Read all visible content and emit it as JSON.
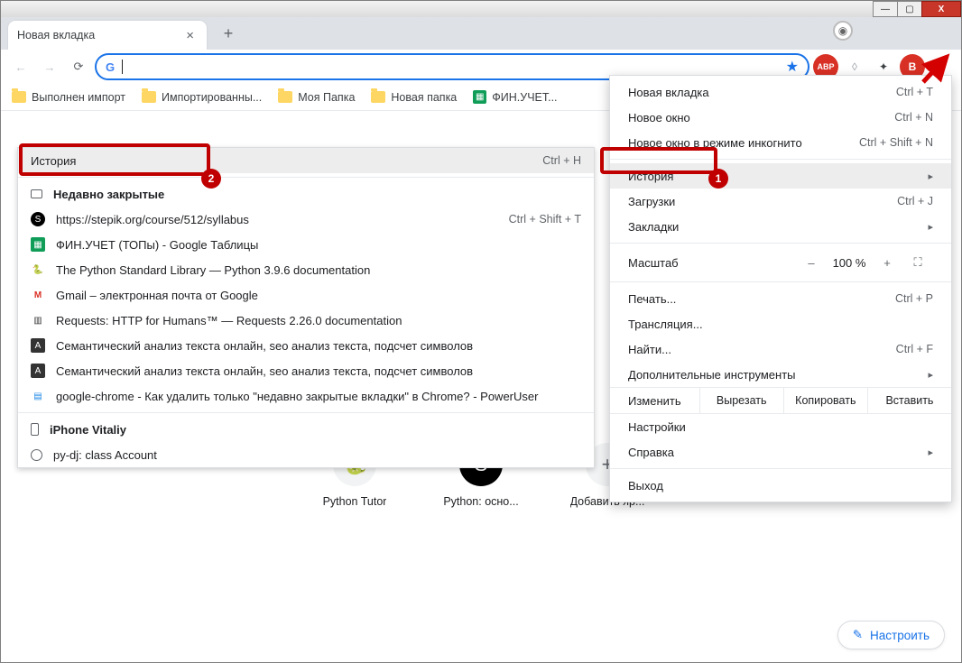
{
  "window": {
    "min": "—",
    "max": "▢",
    "close": "X"
  },
  "tab": {
    "title": "Новая вкладка"
  },
  "toolbar": {
    "profile_letter": "В",
    "abp": "ABP"
  },
  "bookmarks": [
    {
      "label": "Выполнен импорт",
      "type": "folder"
    },
    {
      "label": "Импортированны...",
      "type": "folder"
    },
    {
      "label": "Моя Папка",
      "type": "folder"
    },
    {
      "label": "Новая папка",
      "type": "folder"
    },
    {
      "label": "ФИН.УЧЕТ...",
      "type": "sheet"
    }
  ],
  "submenu": {
    "header": {
      "label": "История",
      "shortcut": "Ctrl + H"
    },
    "recent_label": "Недавно закрытые",
    "recent_shortcut": "Ctrl + Shift + T",
    "items": [
      {
        "icon": "stepik",
        "label": "https://stepik.org/course/512/syllabus"
      },
      {
        "icon": "sheets",
        "label": "ФИН.УЧЕТ (ТОПы) - Google Таблицы"
      },
      {
        "icon": "python",
        "label": "The Python Standard Library — Python 3.9.6 documentation"
      },
      {
        "icon": "gmail",
        "label": "Gmail – электронная почта от Google"
      },
      {
        "icon": "requests",
        "label": "Requests: HTTP for Humans™ — Requests 2.26.0 documentation"
      },
      {
        "icon": "advego",
        "label": "Семантический анализ текста онлайн, seo анализ текста, подсчет символов"
      },
      {
        "icon": "advego",
        "label": "Семантический анализ текста онлайн, seo анализ текста, подсчет символов"
      },
      {
        "icon": "se",
        "label": "google-chrome - Как удалить только \"недавно закрытые вкладки\" в Chrome? - PowerUser"
      }
    ],
    "device_label": "iPhone Vitaliy",
    "device_item": "py-dj: class Account"
  },
  "mainmenu": {
    "items_top": [
      {
        "label": "Новая вкладка",
        "shortcut": "Ctrl + T"
      },
      {
        "label": "Новое окно",
        "shortcut": "Ctrl + N"
      },
      {
        "label": "Новое окно в режиме инкогнито",
        "shortcut": "Ctrl + Shift + N"
      }
    ],
    "history": {
      "label": "История"
    },
    "downloads": {
      "label": "Загрузки",
      "shortcut": "Ctrl + J"
    },
    "bookmarks": {
      "label": "Закладки"
    },
    "zoom": {
      "label": "Масштаб",
      "minus": "–",
      "value": "100 %",
      "plus": "+"
    },
    "print": {
      "label": "Печать...",
      "shortcut": "Ctrl + P"
    },
    "cast": {
      "label": "Трансляция..."
    },
    "find": {
      "label": "Найти...",
      "shortcut": "Ctrl + F"
    },
    "tools": {
      "label": "Дополнительные инструменты"
    },
    "edit": {
      "label": "Изменить",
      "cut": "Вырезать",
      "copy": "Копировать",
      "paste": "Вставить"
    },
    "settings": {
      "label": "Настройки"
    },
    "help": {
      "label": "Справка"
    },
    "exit": {
      "label": "Выход"
    }
  },
  "shortcuts": [
    {
      "label": "Python Tutor",
      "icon": "python"
    },
    {
      "label": "Python: осно...",
      "icon": "stepik"
    },
    {
      "label": "Добавить яр...",
      "icon": "plus"
    }
  ],
  "customize": "Настроить",
  "badges": {
    "one": "1",
    "two": "2"
  }
}
